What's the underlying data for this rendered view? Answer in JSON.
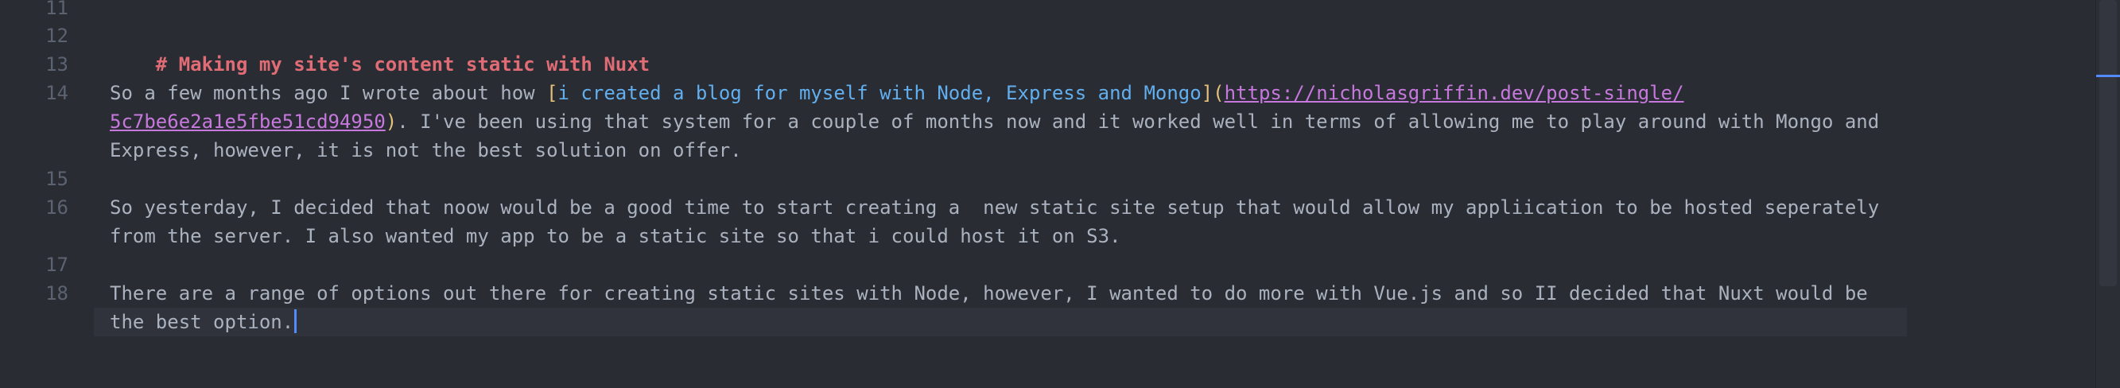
{
  "editor": {
    "line_numbers": [
      "11",
      "12",
      "13",
      "14",
      "15",
      "16",
      "17",
      "18"
    ],
    "line12": {
      "heading": "# Making my site's content static with Nuxt"
    },
    "line14": {
      "prefix": "So a few months ago I wrote about how ",
      "open_bracket": "[",
      "link_text": "i created a blog for myself with Node, Express and Mongo",
      "close_bracket": "]",
      "open_paren": "(",
      "url_part1": "https://nicholasgriffin.dev/post-single/",
      "url_part2": "5c7be6e2a1e5fbe51cd94950",
      "close_paren": ")",
      "rest_wrap1": ". I've been using that system for a couple of months now and it worked well in terms of allowing me to play around with Mongo and",
      "wrap2": "Express, however, it is not the best solution on offer."
    },
    "line16": {
      "wrap1": "So yesterday, I decided that noow would be a good time to start creating a  new static site setup that would allow my appliication to be hosted seperately",
      "wrap2": "from the server. I also wanted my app to be a static site so that i could host it on S3."
    },
    "line18": {
      "wrap1": "There are a range of options out there for creating static sites with Node, however, I wanted to do more with Vue.js and so II decided that Nuxt would be",
      "wrap2": "the best option."
    }
  },
  "colors": {
    "background": "#2a2c33",
    "heading": "#e06c75",
    "bracket": "#e5c07b",
    "link_text": "#61afef",
    "url": "#c678dd",
    "text": "#abb2bf",
    "line_number": "#5c6370",
    "cursor": "#528bff"
  }
}
